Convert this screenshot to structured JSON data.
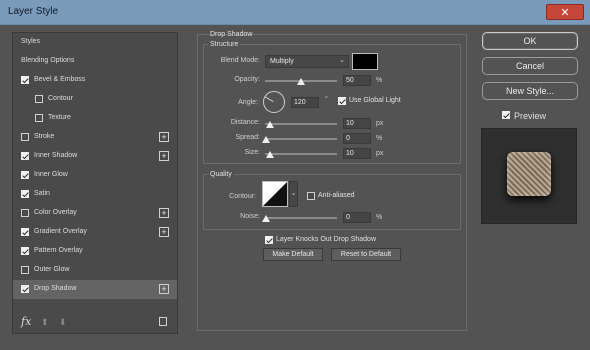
{
  "window": {
    "title": "Layer Style",
    "close_label": "✕"
  },
  "sidebar": {
    "items": [
      {
        "label": "Styles",
        "checkbox": false,
        "checked": false,
        "plus": false,
        "indent": 0
      },
      {
        "label": "Blending Options",
        "checkbox": false,
        "checked": false,
        "plus": false,
        "indent": 0
      },
      {
        "label": "Bevel & Emboss",
        "checkbox": true,
        "checked": true,
        "plus": false,
        "indent": 0
      },
      {
        "label": "Contour",
        "checkbox": true,
        "checked": false,
        "plus": false,
        "indent": 1
      },
      {
        "label": "Texture",
        "checkbox": true,
        "checked": false,
        "plus": false,
        "indent": 1
      },
      {
        "label": "Stroke",
        "checkbox": true,
        "checked": false,
        "plus": true,
        "indent": 0
      },
      {
        "label": "Inner Shadow",
        "checkbox": true,
        "checked": true,
        "plus": true,
        "indent": 0
      },
      {
        "label": "Inner Glow",
        "checkbox": true,
        "checked": true,
        "plus": false,
        "indent": 0
      },
      {
        "label": "Satin",
        "checkbox": true,
        "checked": true,
        "plus": false,
        "indent": 0
      },
      {
        "label": "Color Overlay",
        "checkbox": true,
        "checked": false,
        "plus": true,
        "indent": 0
      },
      {
        "label": "Gradient Overlay",
        "checkbox": true,
        "checked": true,
        "plus": true,
        "indent": 0
      },
      {
        "label": "Pattern Overlay",
        "checkbox": true,
        "checked": true,
        "plus": false,
        "indent": 0
      },
      {
        "label": "Outer Glow",
        "checkbox": true,
        "checked": false,
        "plus": false,
        "indent": 0
      },
      {
        "label": "Drop Shadow",
        "checkbox": true,
        "checked": true,
        "plus": true,
        "indent": 0,
        "selected": true
      }
    ],
    "footer": {
      "fx": "fx",
      "up": "⬆",
      "down": "⬇"
    }
  },
  "drop_shadow": {
    "section_title": "Drop Shadow",
    "structure_title": "Structure",
    "blend_mode_label": "Blend Mode:",
    "blend_mode_value": "Multiply",
    "shadow_color": "#000000",
    "opacity_label": "Opacity:",
    "opacity_value": "50",
    "opacity_unit": "%",
    "angle_label": "Angle:",
    "angle_value": "120",
    "angle_unit": "°",
    "use_global_light_label": "Use Global Light",
    "use_global_light_checked": true,
    "distance_label": "Distance:",
    "distance_value": "10",
    "distance_unit": "px",
    "spread_label": "Spread:",
    "spread_value": "0",
    "spread_unit": "%",
    "size_label": "Size:",
    "size_value": "10",
    "size_unit": "px",
    "quality_title": "Quality",
    "contour_label": "Contour:",
    "anti_aliased_label": "Anti-aliased",
    "anti_aliased_checked": false,
    "noise_label": "Noise:",
    "noise_value": "0",
    "noise_unit": "%",
    "knockout_label": "Layer Knocks Out Drop Shadow",
    "knockout_checked": true,
    "make_default_label": "Make Default",
    "reset_default_label": "Reset to Default"
  },
  "right_panel": {
    "ok_label": "OK",
    "cancel_label": "Cancel",
    "new_style_label": "New Style...",
    "preview_label": "Preview",
    "preview_checked": true
  }
}
